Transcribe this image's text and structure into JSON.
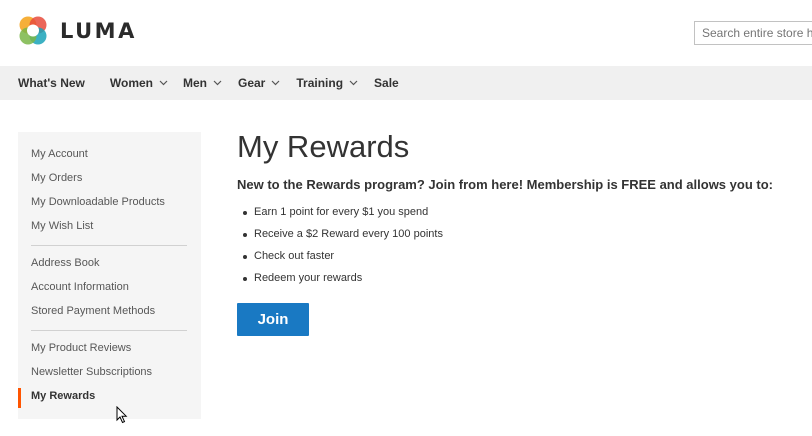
{
  "header": {
    "logo_text": "LUMA",
    "search_placeholder": "Search entire store here..."
  },
  "nav": {
    "items": [
      {
        "label": "What's New",
        "has_dropdown": false
      },
      {
        "label": "Women",
        "has_dropdown": true
      },
      {
        "label": "Men",
        "has_dropdown": true
      },
      {
        "label": "Gear",
        "has_dropdown": true
      },
      {
        "label": "Training",
        "has_dropdown": true
      },
      {
        "label": "Sale",
        "has_dropdown": false
      }
    ]
  },
  "sidebar": {
    "groups": [
      [
        "My Account",
        "My Orders",
        "My Downloadable Products",
        "My Wish List"
      ],
      [
        "Address Book",
        "Account Information",
        "Stored Payment Methods"
      ],
      [
        "My Product Reviews",
        "Newsletter Subscriptions",
        "My Rewards"
      ]
    ],
    "active_item": "My Rewards"
  },
  "main": {
    "title": "My Rewards",
    "intro": "New to the Rewards program? Join from here! Membership is FREE and allows you to:",
    "benefits": [
      "Earn 1 point for every $1 you spend",
      "Receive a $2 Reward every 100 points",
      "Check out faster",
      "Redeem your rewards"
    ],
    "join_label": "Join"
  },
  "colors": {
    "accent_blue": "#1979c3",
    "active_marker": "#ff5501",
    "nav_background": "#f0f0f0",
    "sidebar_background": "#f5f5f5"
  },
  "icons": {
    "logo": "luma-logo-icon",
    "dropdown": "chevron-down-icon",
    "pointer": "mouse-cursor-icon"
  }
}
